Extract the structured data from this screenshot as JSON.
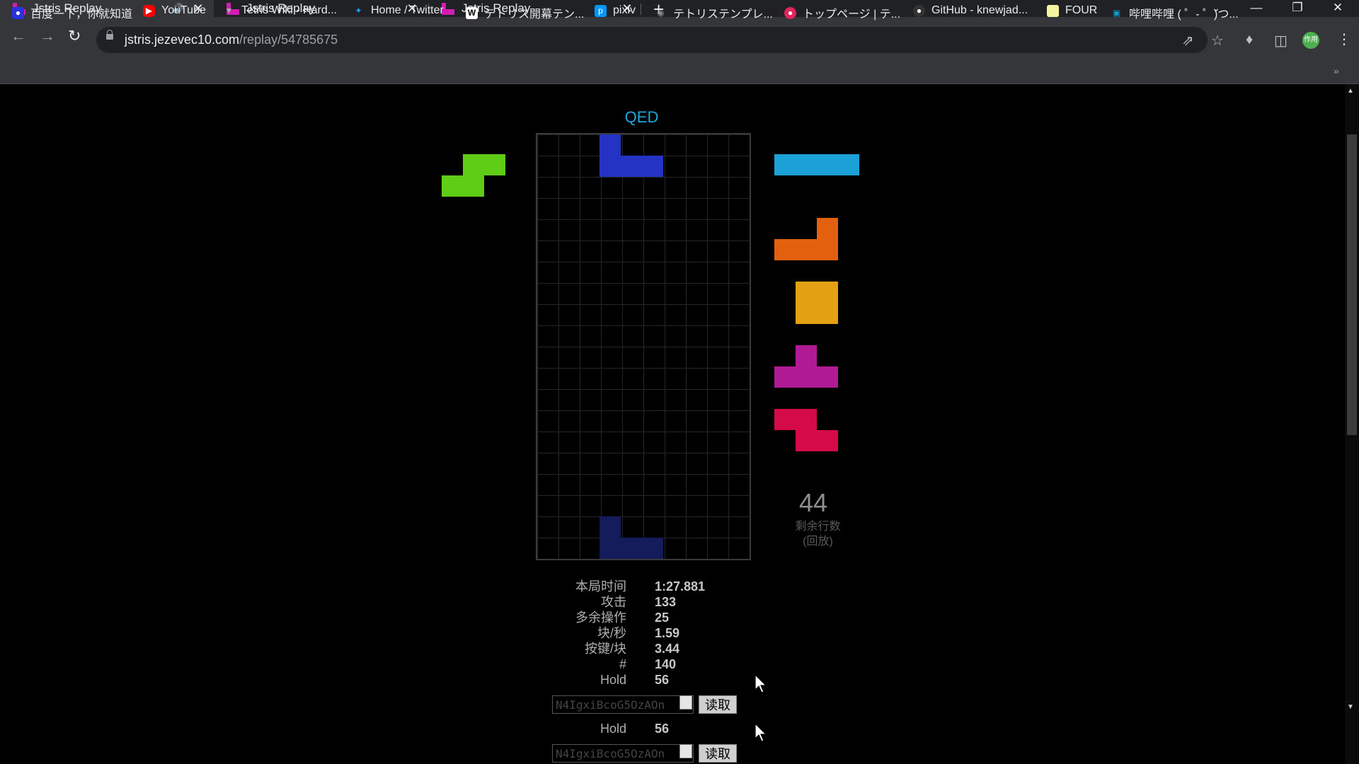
{
  "browser": {
    "tabs": [
      {
        "title": "Jstris Replay",
        "audio": true
      },
      {
        "title": "Jstris Replay"
      },
      {
        "title": "Jstris Replay"
      }
    ],
    "url": {
      "host": "jstris.jezevec10.com",
      "path": "/replay/54785675"
    },
    "profile_label": "作用",
    "bookmarks": [
      {
        "label": "百度一下，你就知道",
        "icon": "baidu-icon",
        "color": "#2932e1"
      },
      {
        "label": "YouTube",
        "icon": "youtube-icon",
        "color": "#ff0000"
      },
      {
        "label": "Tetris Wiki - Hard...",
        "icon": "tetris-wiki-icon",
        "color": "#888888"
      },
      {
        "label": "Home / Twitter",
        "icon": "twitter-icon",
        "color": "#1da1f2"
      },
      {
        "label": "テトリス開幕テン...",
        "icon": "wiki-w-icon",
        "color": "#ffffff"
      },
      {
        "label": "pixiv",
        "icon": "pixiv-icon",
        "color": "#0096fa"
      },
      {
        "label": "テトリステンプレ...",
        "icon": "globe-icon",
        "color": "#555555"
      },
      {
        "label": "トップページ | テ...",
        "icon": "site-icon",
        "color": "#e0245e"
      },
      {
        "label": "GitHub - knewjad...",
        "icon": "github-icon",
        "color": "#333333"
      },
      {
        "label": "FOUR",
        "icon": "four-icon",
        "color": "#f4f4a0"
      },
      {
        "label": "哔哩哔哩 ( ゜- ゜)つ...",
        "icon": "bilibili-icon",
        "color": "#00a1d6"
      }
    ]
  },
  "game": {
    "player_name": "QED",
    "colors": {
      "hold_piece": "#5fcd16",
      "active_piece": "#2433c4",
      "ghost_piece": "#141c5c",
      "next_i": "#1ca1d6",
      "next_l": "#e3600f",
      "next_o": "#e4a013",
      "next_t": "#b01a94",
      "next_z": "#d40b48"
    },
    "hold": "S",
    "next_queue": [
      "I",
      "L",
      "O",
      "T",
      "Z"
    ],
    "active_piece": "J",
    "lines_remaining": "44",
    "lines_label_1": "剩余行数",
    "lines_label_2": "(回放)",
    "stats": [
      {
        "label": "本局时间",
        "value": "1:27.881"
      },
      {
        "label": "攻击",
        "value": "133"
      },
      {
        "label": "多余操作",
        "value": "25"
      },
      {
        "label": "块/秒",
        "value": "1.59"
      },
      {
        "label": "按键/块",
        "value": "3.44"
      },
      {
        "label": "#",
        "value": "140"
      },
      {
        "label": "Hold",
        "value": "56"
      }
    ],
    "duplicate_rows": [
      {
        "label": "Hold",
        "value": "56"
      }
    ],
    "replay_input_value": "N4IgxiBcoG5OzAOn",
    "load_button": "读取"
  }
}
